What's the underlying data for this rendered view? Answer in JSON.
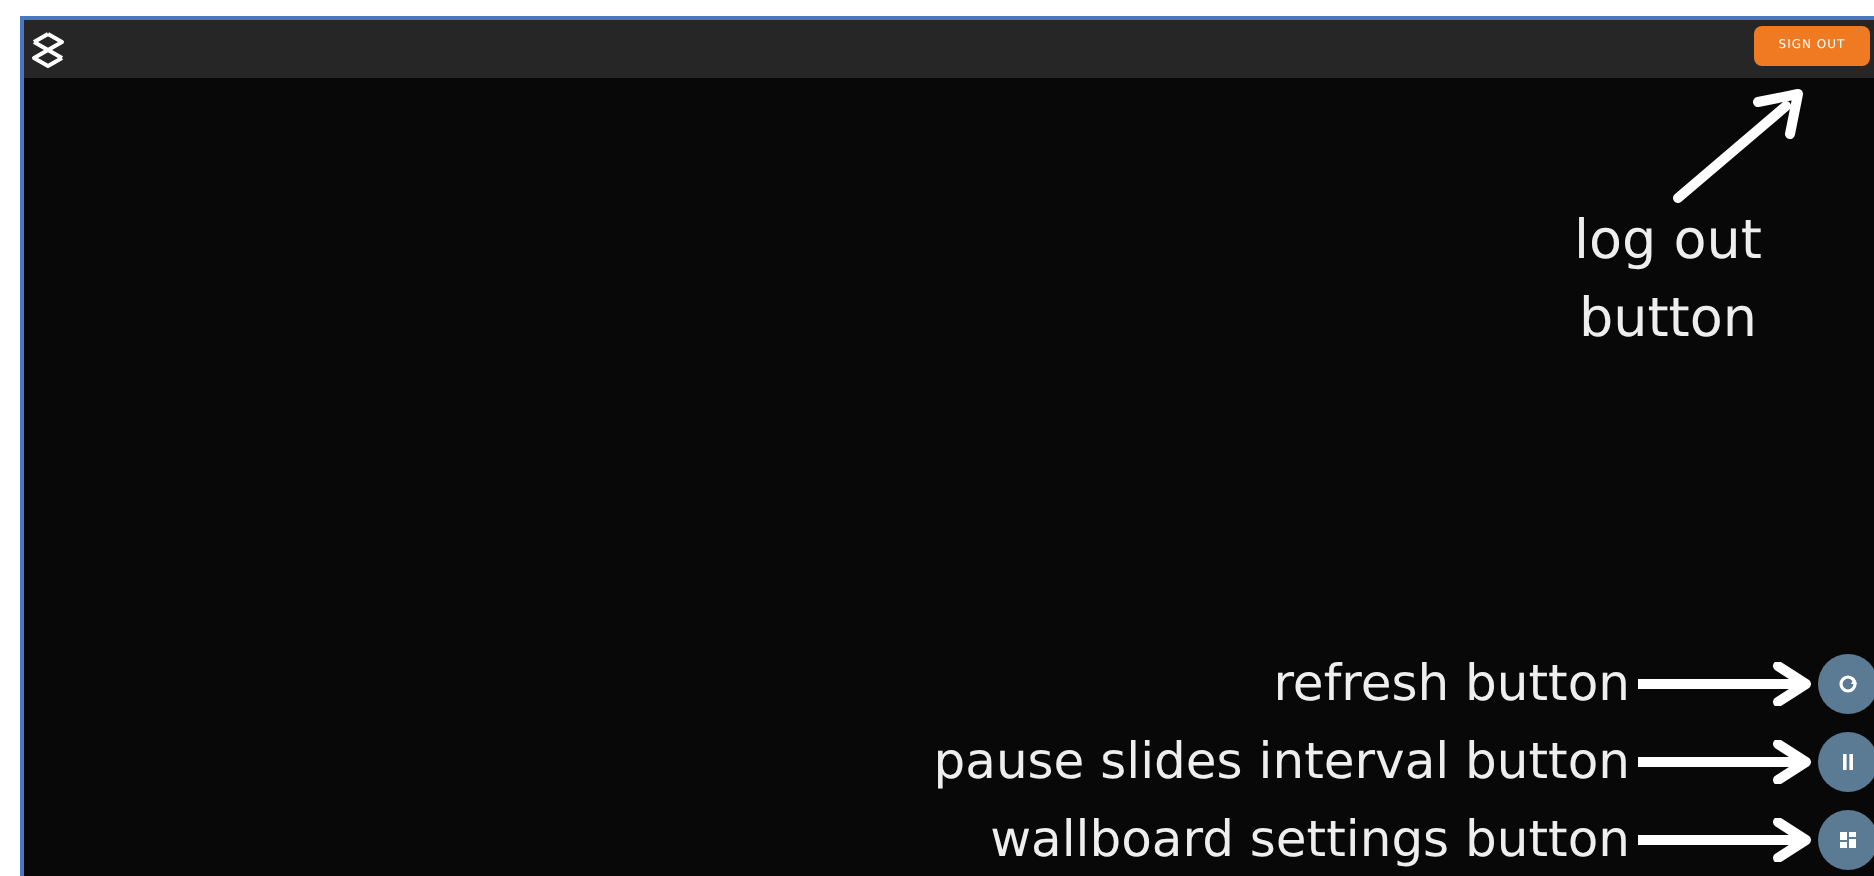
{
  "header": {
    "sign_out_button": "SIGN OUT"
  },
  "callout": {
    "text": "log out button"
  },
  "controls": [
    {
      "kind": "refresh",
      "annotation": "refresh button"
    },
    {
      "kind": "pause",
      "annotation": "pause slides interval button"
    },
    {
      "kind": "settings",
      "annotation": "wallboard settings button"
    }
  ]
}
